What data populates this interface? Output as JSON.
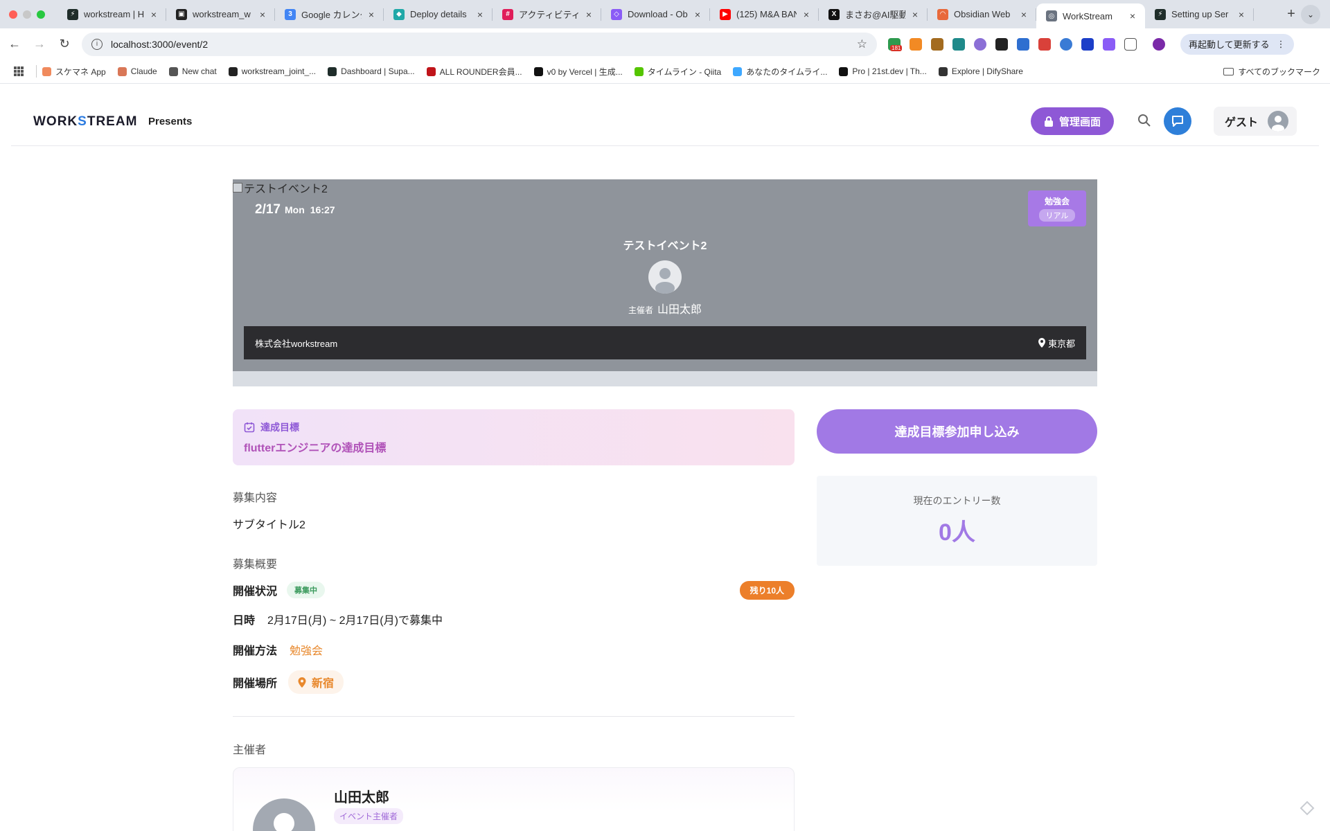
{
  "browser": {
    "tabs": [
      {
        "title": "workstream | H",
        "color": "#1f2d2a",
        "glyph": "⚡"
      },
      {
        "title": "workstream_w",
        "color": "#222222",
        "glyph": "▣"
      },
      {
        "title": "Google カレンダ",
        "color": "#4285f4",
        "glyph": "3"
      },
      {
        "title": "Deploy details",
        "color": "#20a8a8",
        "glyph": "◆"
      },
      {
        "title": "アクティビティ -",
        "color": "#e01e5a",
        "glyph": "#"
      },
      {
        "title": "Download - Ob",
        "color": "#8a5cf6",
        "glyph": "◇"
      },
      {
        "title": "(125) M&A BAN",
        "color": "#ff0000",
        "glyph": "▶"
      },
      {
        "title": "まさお@AI駆動",
        "color": "#111111",
        "glyph": "X"
      },
      {
        "title": "Obsidian Web",
        "color": "#e8693a",
        "glyph": "◠"
      },
      {
        "title": "WorkStream",
        "color": "#6b7380",
        "glyph": "◎",
        "active": true
      },
      {
        "title": "Setting up Ser",
        "color": "#1f2d2a",
        "glyph": "⚡"
      }
    ],
    "url": "localhost:3000/event/2",
    "relaunch_label": "再起動して更新する",
    "ext_badge": "181",
    "bookmarks": [
      {
        "label": "スケマネ App",
        "color": "#f08a5d"
      },
      {
        "label": "Claude",
        "color": "#d97757"
      },
      {
        "label": "New chat",
        "color": "#555555"
      },
      {
        "label": "workstream_joint_...",
        "color": "#222222"
      },
      {
        "label": "Dashboard | Supa...",
        "color": "#1f2d2a"
      },
      {
        "label": "ALL ROUNDER会員...",
        "color": "#c0141a"
      },
      {
        "label": "v0 by Vercel | 生成...",
        "color": "#111111"
      },
      {
        "label": "タイムライン - Qiita",
        "color": "#55c500"
      },
      {
        "label": "あなたのタイムライ...",
        "color": "#3ea8ff"
      },
      {
        "label": "Pro | 21st.dev | Th...",
        "color": "#111111"
      },
      {
        "label": "Explore | DifyShare",
        "color": "#333333"
      }
    ],
    "all_bookmarks_label": "すべてのブックマーク"
  },
  "header": {
    "logo_left": "WORK",
    "logo_s": "S",
    "logo_right": "TREAM",
    "presents": "Presents",
    "admin_label": "管理画面",
    "guest_label": "ゲスト"
  },
  "hero": {
    "image_alt": "テストイベント2",
    "date": "2/17",
    "weekday": "Mon",
    "time": "16:27",
    "category": "勉強会",
    "format": "リアル",
    "title": "テストイベント2",
    "host_label": "主催者",
    "host_name": "山田太郎",
    "company": "株式会社workstream",
    "location": "東京都"
  },
  "goal": {
    "label": "達成目標",
    "text": "flutterエンジニアの達成目標"
  },
  "apply_button": "達成目標参加申し込み",
  "entries": {
    "label": "現在のエントリー数",
    "count": "0人"
  },
  "details": {
    "content_heading": "募集内容",
    "subtitle": "サブタイトル2",
    "overview_heading": "募集概要",
    "status_key": "開催状況",
    "status_value": "募集中",
    "remaining": "残り10人",
    "datetime_key": "日時",
    "datetime_value": "2月17日(月) ~ 2月17日(月)で募集中",
    "method_key": "開催方法",
    "method_value": "勉強会",
    "place_key": "開催場所",
    "place_value": "新宿"
  },
  "organizer": {
    "heading": "主催者",
    "name": "山田太郎",
    "role": "イベント主催者"
  },
  "colors": {
    "accent": "#8e58d6",
    "apply": "#a179e5",
    "chat": "#2e7fd9",
    "orange": "#e8882c"
  }
}
